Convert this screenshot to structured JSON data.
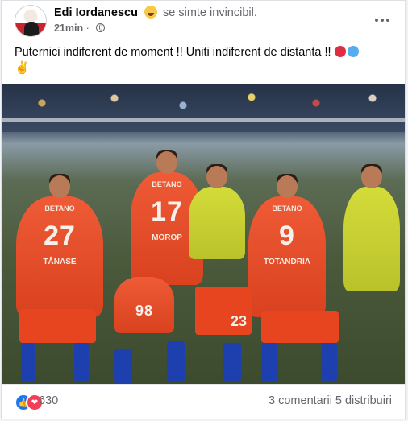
{
  "post": {
    "author": "Edi Iordanescu",
    "feeling_text": "se simte invincibil.",
    "time": "21min",
    "separator": "·",
    "text_line1": "Puternici indiferent de moment !! Uniti indiferent de distanta !!",
    "text_line2": "✌"
  },
  "photo": {
    "players": [
      {
        "number": "27",
        "sponsor": "BETANO",
        "name": "TÂNASE"
      },
      {
        "number": "17",
        "sponsor": "BETANO",
        "name": "MOROP"
      },
      {
        "number": "9",
        "sponsor": "BETANO",
        "name": "TOTANDRIA"
      },
      {
        "number": "98",
        "sponsor": "",
        "name": ""
      },
      {
        "number": "23",
        "sponsor": "",
        "name": ""
      }
    ]
  },
  "footer": {
    "reaction_count": "630",
    "comments": "3 comentarii",
    "shares": "5 distribuiri"
  },
  "colors": {
    "brand_blue": "#1877f2",
    "love_red": "#f33e58",
    "kit_red": "#e6451f",
    "kit_blue": "#1e3fae",
    "vest_yellow": "#d4dc3a"
  },
  "icons": {
    "feeling": "grinning-tear-emoji-icon",
    "privacy": "globe-icon",
    "more": "more-options-icon",
    "like": "like-icon",
    "love": "love-icon"
  }
}
